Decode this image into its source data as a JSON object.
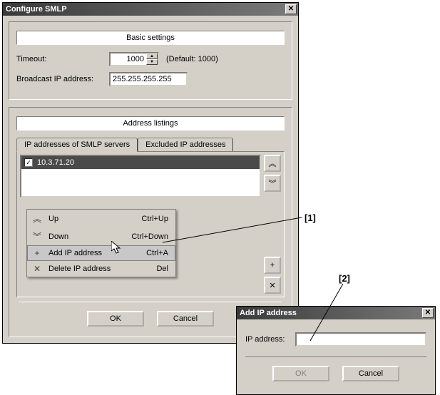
{
  "main_window": {
    "title": "Configure SMLP",
    "basic_settings_header": "Basic settings",
    "timeout_label": "Timeout:",
    "timeout_value": "1000",
    "timeout_default": "(Default: 1000)",
    "broadcast_label": "Broadcast IP address:",
    "broadcast_value": "255.255.255.255",
    "address_listings_header": "Address listings",
    "tabs": {
      "servers": "IP addresses of SMLP servers",
      "excluded": "Excluded IP addresses"
    },
    "list_item": "10.3.71.20",
    "context_menu": {
      "up": {
        "label": "Up",
        "shortcut": "Ctrl+Up"
      },
      "down": {
        "label": "Down",
        "shortcut": "Ctrl+Down"
      },
      "add": {
        "label": "Add IP address",
        "shortcut": "Ctrl+A"
      },
      "delete": {
        "label": "Delete IP address",
        "shortcut": "Del"
      }
    },
    "ok": "OK",
    "cancel": "Cancel"
  },
  "add_dialog": {
    "title": "Add IP address",
    "ip_label": "IP address:",
    "ip_value": "",
    "ok": "OK",
    "cancel": "Cancel"
  },
  "callouts": {
    "one": "[1]",
    "two": "[2]"
  },
  "icons": {
    "close": "✕",
    "check": "✓",
    "dbl_up": "︽",
    "dbl_down": "︾",
    "plus": "+",
    "x": "✕",
    "spin_up": "▲",
    "spin_down": "▼"
  }
}
